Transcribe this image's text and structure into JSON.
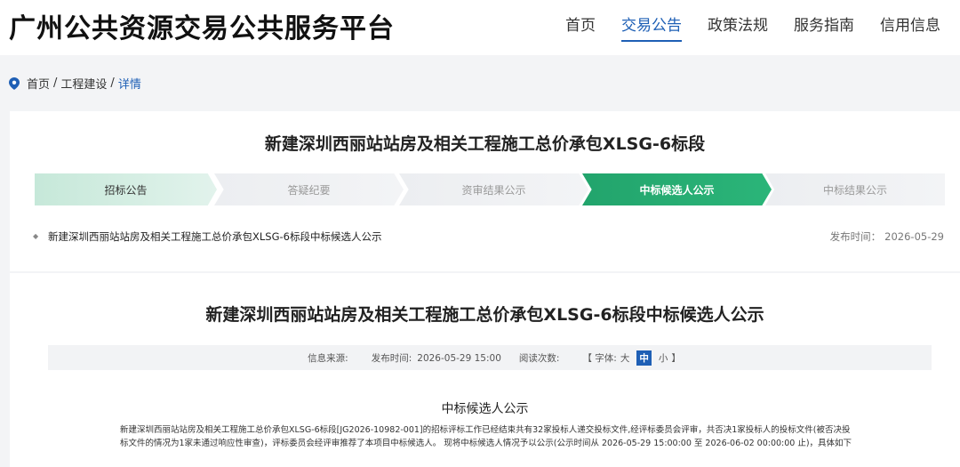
{
  "header": {
    "site_title": "广州公共资源交易公共服务平台",
    "nav": [
      {
        "label": "首页",
        "active": false
      },
      {
        "label": "交易公告",
        "active": true
      },
      {
        "label": "政策法规",
        "active": false
      },
      {
        "label": "服务指南",
        "active": false
      },
      {
        "label": "信用信息",
        "active": false
      }
    ]
  },
  "breadcrumb": {
    "items": [
      "首页",
      "工程建设",
      "详情"
    ],
    "separator": "/"
  },
  "project": {
    "title": "新建深圳西丽站站房及相关工程施工总价承包XLSG-6标段"
  },
  "steps": [
    {
      "label": "招标公告",
      "state": "done"
    },
    {
      "label": "答疑纪要",
      "state": "pending"
    },
    {
      "label": "资审结果公示",
      "state": "pending"
    },
    {
      "label": "中标候选人公示",
      "state": "current"
    },
    {
      "label": "中标结果公示",
      "state": "pending"
    }
  ],
  "notice": {
    "link_text": "新建深圳西丽站站房及相关工程施工总价承包XLSG-6标段中标候选人公示",
    "date_label": "发布时间：",
    "date_value": "2026-05-29"
  },
  "article": {
    "title": "新建深圳西丽站站房及相关工程施工总价承包XLSG-6标段中标候选人公示",
    "meta": {
      "source_label": "信息来源:",
      "source_value": "",
      "publish_label": "发布时间:",
      "publish_value": "2026-05-29 15:00",
      "views_label": "阅读次数:",
      "views_value": "",
      "font_open": "【 字体:",
      "font_large": "大",
      "font_medium": "中",
      "font_small": "小",
      "font_close": "】"
    },
    "section_title": "中标候选人公示",
    "body": "新建深圳西丽站站房及相关工程施工总价承包XLSG-6标段[JG2026-10982-001]的招标评标工作已经结束共有32家投标人递交投标文件,经评标委员会评审，共否决1家投标人的投标文件(被否决投标文件的情况为1家未通过响应性审查)，评标委员会经评审推荐了本项目中标候选人。 现将中标候选人情况予以公示(公示时间从 2026-05-29 15:00:00 至 2026-06-02 00:00:00 止)，具体如下"
  },
  "colors": {
    "accent": "#1e5fb5",
    "step_current": "#2bb579",
    "step_done": "#c6e8d9"
  }
}
